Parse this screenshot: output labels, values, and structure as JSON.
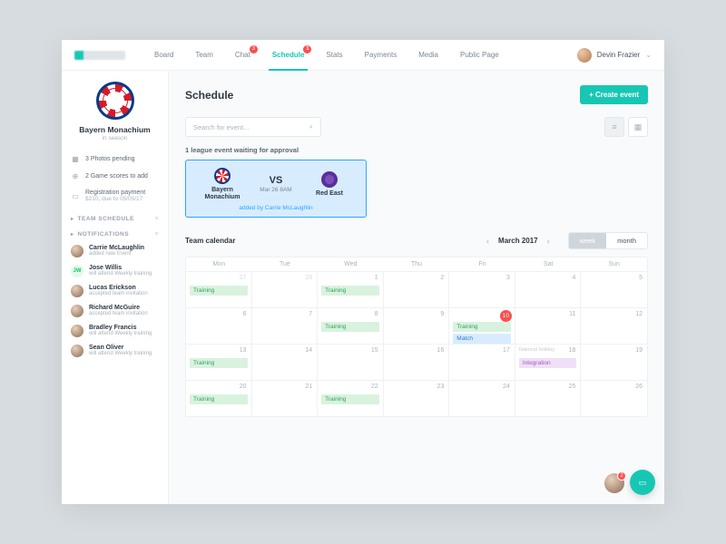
{
  "header": {
    "nav": [
      "Board",
      "Team",
      "Chat",
      "Schedule",
      "Stats",
      "Payments",
      "Media",
      "Public Page"
    ],
    "active_index": 3,
    "badges": {
      "2": "3",
      "3": "1"
    },
    "user": "Devin Frazier"
  },
  "sidebar": {
    "club_name": "Bayern Monachium",
    "club_sub": "in season",
    "stats": [
      {
        "icon": "▦",
        "text": "3 Photos pending"
      },
      {
        "icon": "⊕",
        "text": "2 Game scores to add"
      },
      {
        "icon": "▭",
        "text": "Registration payment",
        "sub": "$210, due to 05/05/17"
      }
    ],
    "sections": [
      {
        "title": "TEAM SCHEDULE"
      },
      {
        "title": "NOTIFICATIONS"
      }
    ],
    "notifs": [
      {
        "name": "Carrie McLaughlin",
        "act": "added new Event"
      },
      {
        "name": "Jose Willis",
        "act": "will attend Weekly training",
        "initials": "JW"
      },
      {
        "name": "Lucas Erickson",
        "act": "accepted team invitation"
      },
      {
        "name": "Richard McGuire",
        "act": "accepted team invitation"
      },
      {
        "name": "Bradley Francis",
        "act": "will attend Weekly training"
      },
      {
        "name": "Sean Oliver",
        "act": "will attend Weekly training"
      }
    ]
  },
  "main": {
    "title": "Schedule",
    "create_btn": "+ Create event",
    "search_ph": "Search for event...",
    "pending_label": "1 league event waiting for approval",
    "match": {
      "team_a": "Bayern Monachium",
      "team_b": "Red East",
      "vs": "VS",
      "date": "Mar 26 8AM",
      "added_by": "added by Carrie McLaughlin"
    },
    "cal_label": "Team calendar",
    "month": "March 2017",
    "seg": [
      "week",
      "month"
    ],
    "seg_sel": 0,
    "days": [
      "Mon",
      "Tue",
      "Wed",
      "Thu",
      "Fri",
      "Sat",
      "Sun"
    ],
    "cells": [
      {
        "n": "27",
        "out": true,
        "ev": [
          {
            "t": "Training",
            "c": "tr"
          }
        ]
      },
      {
        "n": "28",
        "out": true
      },
      {
        "n": "1",
        "ev": [
          {
            "t": "Training",
            "c": "tr"
          }
        ]
      },
      {
        "n": "2"
      },
      {
        "n": "3"
      },
      {
        "n": "4"
      },
      {
        "n": "5"
      },
      {
        "n": "6"
      },
      {
        "n": "7"
      },
      {
        "n": "8",
        "ev": [
          {
            "t": "Training",
            "c": "tr"
          }
        ]
      },
      {
        "n": "9"
      },
      {
        "n": "10",
        "today": true,
        "ev": [
          {
            "t": "Training",
            "c": "tr"
          },
          {
            "t": "Match",
            "c": "mt"
          }
        ]
      },
      {
        "n": "11"
      },
      {
        "n": "12"
      },
      {
        "n": "13",
        "ev": [
          {
            "t": "Training",
            "c": "tr"
          }
        ]
      },
      {
        "n": "14"
      },
      {
        "n": "15"
      },
      {
        "n": "16"
      },
      {
        "n": "17"
      },
      {
        "n": "18",
        "hol": "National holiday",
        "ev": [
          {
            "t": "Integration",
            "c": "it"
          }
        ]
      },
      {
        "n": "19"
      },
      {
        "n": "20",
        "ev": [
          {
            "t": "Training",
            "c": "tr"
          }
        ]
      },
      {
        "n": "21"
      },
      {
        "n": "22",
        "ev": [
          {
            "t": "Training",
            "c": "tr"
          }
        ]
      },
      {
        "n": "23"
      },
      {
        "n": "24"
      },
      {
        "n": "25"
      },
      {
        "n": "26"
      }
    ],
    "fab_badge": "2"
  }
}
